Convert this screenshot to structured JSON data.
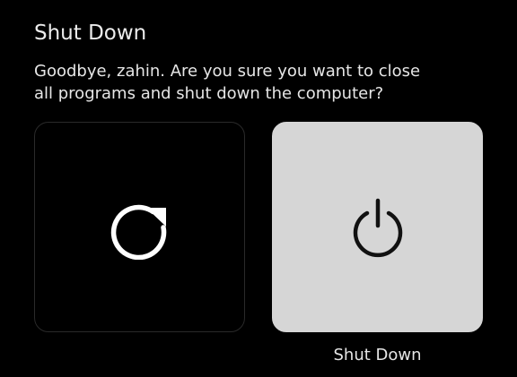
{
  "dialog": {
    "title": "Shut Down",
    "message_line1": "Goodbye, zahin. Are you sure you want to close",
    "message_line2": "all programs and shut down the computer?"
  },
  "options": {
    "restart": {
      "icon": "restart-icon",
      "background": "#000000"
    },
    "shutdown": {
      "label": "Shut Down",
      "icon": "power-icon",
      "background": "#d6d6d6"
    }
  },
  "colors": {
    "background": "#000000",
    "text": "#e9e9e9",
    "selected_tile": "#d6d6d6"
  }
}
